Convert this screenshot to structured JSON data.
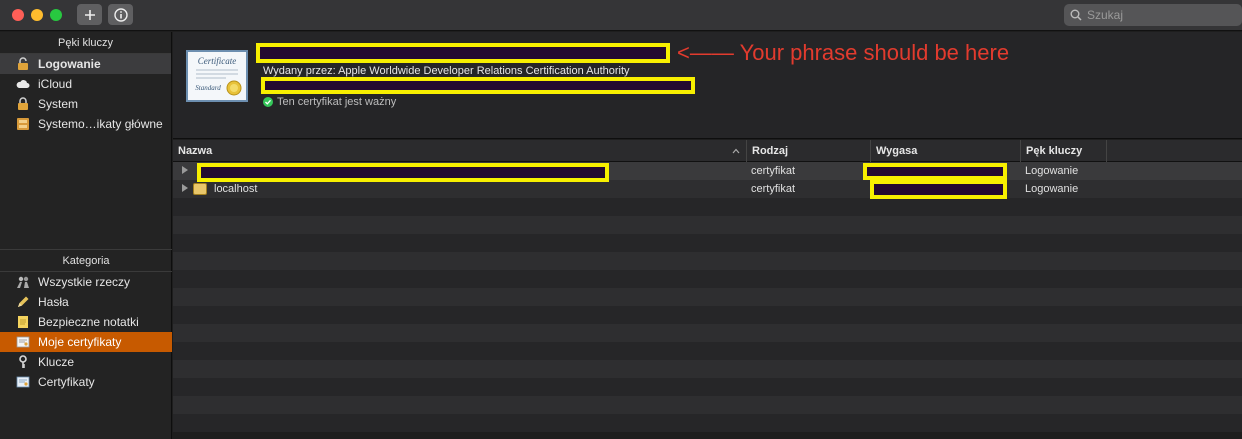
{
  "toolbar": {
    "add_label": "+",
    "info_label": "i"
  },
  "search": {
    "placeholder": "Szukaj"
  },
  "sidebar": {
    "keychains_header": "Pęki kluczy",
    "keychains": [
      {
        "label": "Logowanie",
        "icon": "lock-open-icon"
      },
      {
        "label": "iCloud",
        "icon": "cloud-icon"
      },
      {
        "label": "System",
        "icon": "lock-icon"
      },
      {
        "label": "Systemo…ikaty główne",
        "icon": "cabinet-icon"
      }
    ],
    "category_header": "Kategoria",
    "categories": [
      {
        "label": "Wszystkie rzeczy",
        "icon": "people-icon"
      },
      {
        "label": "Hasła",
        "icon": "pencil-icon"
      },
      {
        "label": "Bezpieczne notatki",
        "icon": "note-icon"
      },
      {
        "label": "Moje certyfikaty",
        "icon": "my-certificate-icon"
      },
      {
        "label": "Klucze",
        "icon": "key-icon"
      },
      {
        "label": "Certyfikaty",
        "icon": "certificate-icon"
      }
    ]
  },
  "cert_info": {
    "issuer": "Wydany przez: Apple Worldwide Developer Relations Certification Authority",
    "status": "Ten certyfikat jest ważny",
    "annotation": "<—— Your phrase should be here",
    "thumbnail_top": "Certificate",
    "thumbnail_bottom": "Standard"
  },
  "table": {
    "columns": [
      "Nazwa",
      "Rodzaj",
      "Wygasa",
      "Pęk kluczy"
    ],
    "rows": [
      {
        "name": "",
        "kind": "certyfikat",
        "expires": "",
        "keychain": "Logowanie"
      },
      {
        "name": "localhost",
        "kind": "certyfikat",
        "expires": "",
        "keychain": "Logowanie"
      }
    ]
  },
  "colors": {
    "accent": "#c75a00",
    "redaction_border": "#f7ef00",
    "annotation": "#e23b2e",
    "valid": "#34c759"
  }
}
